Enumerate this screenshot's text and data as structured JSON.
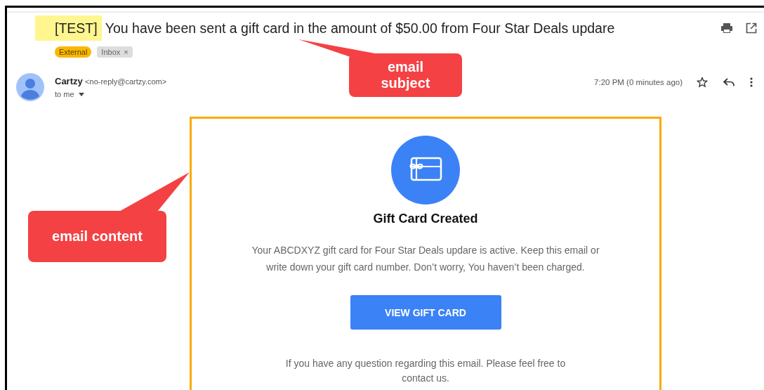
{
  "subject": {
    "tag": "[TEST]",
    "text": "You have been sent a gift card in the amount of $50.00 from Four Star Deals updare"
  },
  "labels": [
    {
      "text": "External",
      "kind": "external"
    },
    {
      "text": "Inbox",
      "kind": "folder",
      "remove": "×"
    }
  ],
  "sender": {
    "name": "Cartzy",
    "address": "<no-reply@cartzy.com>",
    "recipient": "to me",
    "time": "7:20 PM (0 minutes ago)"
  },
  "content": {
    "heading": "Gift Card Created",
    "body": "Your ABCDXYZ gift card for Four Star Deals updare is active. Keep this email or write down your gift card number. Don’t worry, You haven’t been charged.",
    "button": "VIEW GIFT CARD",
    "footer": "If you have any question regarding this email. Please feel free to contact us."
  },
  "callouts": [
    {
      "text": "email subject",
      "kind": "subject"
    },
    {
      "text": "email content",
      "kind": "content"
    }
  ]
}
